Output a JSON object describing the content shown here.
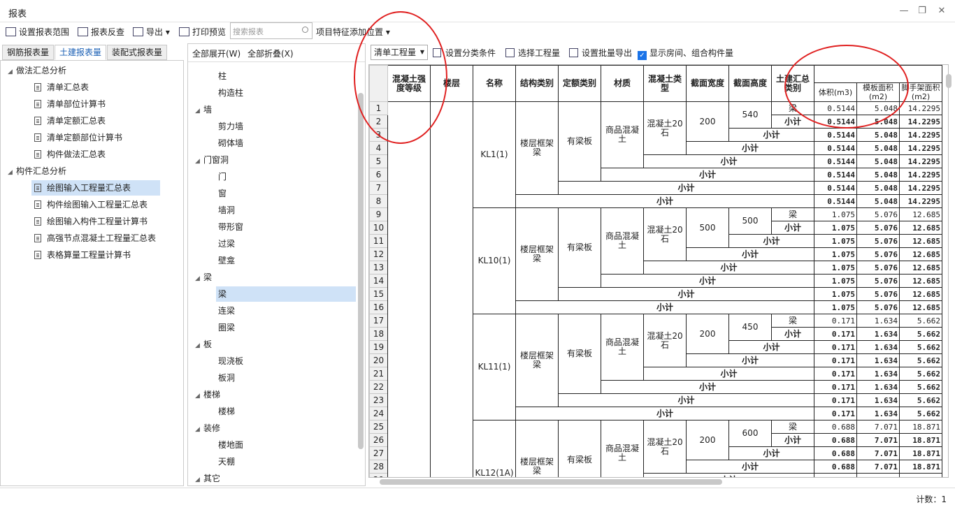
{
  "window": {
    "title": "报表"
  },
  "toolbar": {
    "set_range": "设置报表范围",
    "reverse": "报表反查",
    "export": "导出",
    "print_preview": "打印预览",
    "search_placeholder": "搜索报表",
    "feature_setting": "项目特征添加位置"
  },
  "left_tabs": [
    "钢筋报表量",
    "土建报表量",
    "装配式报表量"
  ],
  "left_tree": [
    {
      "label": "做法汇总分析",
      "level": 0,
      "group": true
    },
    {
      "label": "清单汇总表",
      "level": 1
    },
    {
      "label": "清单部位计算书",
      "level": 1
    },
    {
      "label": "清单定额汇总表",
      "level": 1
    },
    {
      "label": "清单定额部位计算书",
      "level": 1
    },
    {
      "label": "构件做法汇总表",
      "level": 1
    },
    {
      "label": "构件汇总分析",
      "level": 0,
      "group": true
    },
    {
      "label": "绘图输入工程量汇总表",
      "level": 1,
      "selected": true
    },
    {
      "label": "构件绘图输入工程量汇总表",
      "level": 1
    },
    {
      "label": "绘图输入构件工程量计算书",
      "level": 1
    },
    {
      "label": "高强节点混凝土工程量汇总表",
      "level": 1
    },
    {
      "label": "表格算量工程量计算书",
      "level": 1
    }
  ],
  "mid": {
    "expand_all": "全部展开(W)",
    "collapse_all": "全部折叠(X)",
    "items": [
      {
        "label": "柱",
        "level": 1
      },
      {
        "label": "构造柱",
        "level": 1
      },
      {
        "label": "墙",
        "level": 0
      },
      {
        "label": "剪力墙",
        "level": 1
      },
      {
        "label": "砌体墙",
        "level": 1
      },
      {
        "label": "门窗洞",
        "level": 0
      },
      {
        "label": "门",
        "level": 1
      },
      {
        "label": "窗",
        "level": 1
      },
      {
        "label": "墙洞",
        "level": 1
      },
      {
        "label": "带形窗",
        "level": 1
      },
      {
        "label": "过梁",
        "level": 1
      },
      {
        "label": "壁龛",
        "level": 1
      },
      {
        "label": "梁",
        "level": 0
      },
      {
        "label": "梁",
        "level": 1,
        "selected": true
      },
      {
        "label": "连梁",
        "level": 1
      },
      {
        "label": "圈梁",
        "level": 1
      },
      {
        "label": "板",
        "level": 0
      },
      {
        "label": "现浇板",
        "level": 1
      },
      {
        "label": "板洞",
        "level": 1
      },
      {
        "label": "楼梯",
        "level": 0
      },
      {
        "label": "楼梯",
        "level": 1
      },
      {
        "label": "装修",
        "level": 0
      },
      {
        "label": "楼地面",
        "level": 1
      },
      {
        "label": "天棚",
        "level": 1
      },
      {
        "label": "其它",
        "level": 0
      }
    ]
  },
  "right_toolbar": {
    "combo": "清单工程量",
    "set_class": "设置分类条件",
    "select_qty": "选择工程量",
    "batch_export": "设置批量导出",
    "show_room": "显示房间、组合构件量"
  },
  "grid": {
    "headers": [
      "混凝土强度等级",
      "楼层",
      "名称",
      "结构类别",
      "定额类别",
      "材质",
      "混凝土类型",
      "截面宽度",
      "截面高度",
      "土建汇总类别"
    ],
    "sub_headers": [
      "体积(m3)",
      "模板面积(m2)",
      "脚手架面积(m2)"
    ],
    "subtotal": "小计",
    "beam": "梁",
    "groups": [
      {
        "name": "KL1(1)",
        "struct": "楼层框架梁",
        "quota": "有梁板",
        "material": "商品混凝土",
        "ctype": "混凝土20石",
        "width": "200",
        "height": "540",
        "v": "0.5144",
        "m": "5.048",
        "s": "14.2295"
      },
      {
        "name": "KL10(1)",
        "struct": "楼层框架梁",
        "quota": "有梁板",
        "material": "商品混凝土",
        "ctype": "混凝土20石",
        "width": "500",
        "height": "500",
        "v": "1.075",
        "m": "5.076",
        "s": "12.685"
      },
      {
        "name": "KL11(1)",
        "struct": "楼层框架梁",
        "quota": "有梁板",
        "material": "商品混凝土",
        "ctype": "混凝土20石",
        "width": "200",
        "height": "450",
        "v": "0.171",
        "m": "1.634",
        "s": "5.662"
      },
      {
        "name": "KL12(1A)",
        "struct": "楼层框架梁",
        "quota": "有梁板",
        "material": "商品混凝土",
        "ctype": "混凝土20石",
        "width": "200",
        "height": "600",
        "v": "0.688",
        "m": "7.071",
        "s": "18.871"
      }
    ]
  },
  "status": {
    "count": "计数：1"
  }
}
